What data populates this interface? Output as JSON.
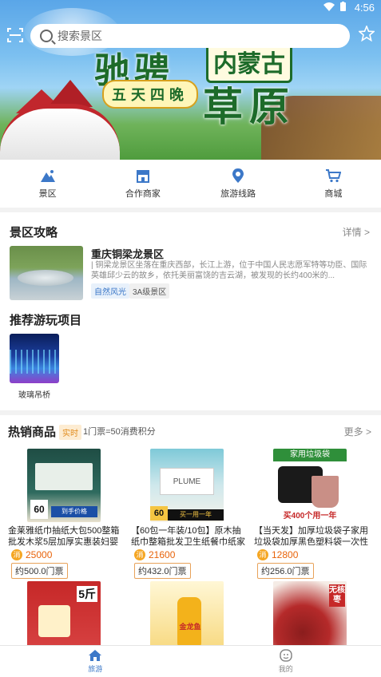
{
  "status_bar": {
    "time": "4:56",
    "icons": [
      "wifi-icon",
      "battery-icon"
    ]
  },
  "search": {
    "placeholder": "搜索景区"
  },
  "banner": {
    "title_main": "驰骋",
    "title_tag": "内蒙古",
    "subtitle": "五天四晚",
    "title_sub": "草原"
  },
  "categories": [
    {
      "label": "景区",
      "icon": "mountain-icon"
    },
    {
      "label": "合作商家",
      "icon": "store-icon"
    },
    {
      "label": "旅游线路",
      "icon": "location-pin-icon"
    },
    {
      "label": "商城",
      "icon": "cart-icon"
    }
  ],
  "guide_section": {
    "title": "景区攻略",
    "more": "详情 >",
    "spot": {
      "name": "重庆铜梁龙景区",
      "desc": "| 铜梁龙景区坐落在重庆西部，长江上游，位于中国人民志愿军特等功臣、国际英雄邱少云的故乡，依托美丽富饶的吉云湖，被发现的长约400米的...",
      "tags": [
        "自然风光",
        "3A级景区"
      ]
    }
  },
  "project_section": {
    "title": "推荐游玩项目",
    "items": [
      {
        "name": "玻璃吊桥"
      }
    ]
  },
  "hot_section": {
    "title": "热销商品",
    "badge": "实时",
    "note": "1门票=50消费积分",
    "more": "更多 >",
    "products": [
      {
        "name": "金莱雅纸巾抽纸大包500整箱批发木浆5层加厚实惠装妇婴抽...",
        "coin": "消",
        "price": "25000",
        "tickets": "约500.0门票"
      },
      {
        "name": "【60包一年装/10包】原木抽纸巾整箱批发卫生纸餐巾纸家用...",
        "coin": "消",
        "price": "21600",
        "tickets": "约432.0门票"
      },
      {
        "name": "【当天发】加厚垃圾袋子家用垃圾袋加厚黑色塑料袋一次性手...",
        "coin": "消",
        "price": "12800",
        "tickets": "约256.0门票"
      }
    ],
    "row2_labels": {
      "rice_weight": "5斤",
      "oil_brand": "金龙鱼",
      "dates_tag": "无核枣"
    }
  },
  "product_images": {
    "p1": {
      "band": "60",
      "caption": "到手价格"
    },
    "p2": {
      "band": "60",
      "caption": "买一用一年"
    },
    "p3": {
      "top": "家用垃圾袋",
      "bottom": "买400个用一年"
    }
  },
  "bottom_nav": [
    {
      "label": "旅游",
      "icon": "home-icon",
      "active": true
    },
    {
      "label": "我的",
      "icon": "profile-icon",
      "active": false
    }
  ],
  "colors": {
    "accent_blue": "#3c78c8",
    "price_orange": "#e8630a",
    "coin": "#f5a623"
  }
}
